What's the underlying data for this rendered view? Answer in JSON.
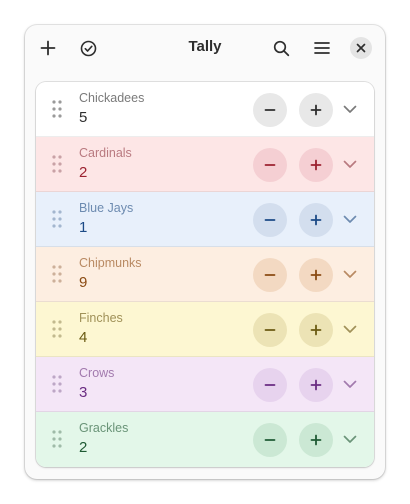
{
  "header": {
    "title": "Tally",
    "icons": [
      "add-icon",
      "check-circle-icon",
      "search-icon",
      "menu-icon",
      "close-icon"
    ]
  },
  "counters": [
    {
      "name": "Chickadees",
      "count": "5",
      "colors": {
        "bg": "#ffffff",
        "name": "#7a7a7a",
        "count": "#2e2e2e",
        "btn": "#e8e8e8",
        "icon": "#2e2e2e",
        "drag": "#9a9a9a",
        "chev": "#7a7a7a"
      }
    },
    {
      "name": "Cardinals",
      "count": "2",
      "colors": {
        "bg": "#fde6e6",
        "name": "#b97a80",
        "count": "#9c2230",
        "btn": "#f5cfd3",
        "icon": "#9c2230",
        "drag": "#c9a2a6",
        "chev": "#b97a80"
      }
    },
    {
      "name": "Blue Jays",
      "count": "1",
      "colors": {
        "bg": "#e8f0fb",
        "name": "#6d8bb0",
        "count": "#1c4a86",
        "btn": "#d3deee",
        "icon": "#1c4a86",
        "drag": "#a3b6cf",
        "chev": "#6d8bb0"
      }
    },
    {
      "name": "Chipmunks",
      "count": "9",
      "colors": {
        "bg": "#fdeee1",
        "name": "#b98a63",
        "count": "#8a4a12",
        "btn": "#f3d9c2",
        "icon": "#8a4a12",
        "drag": "#cdb09a",
        "chev": "#b98a63"
      }
    },
    {
      "name": "Finches",
      "count": "4",
      "colors": {
        "bg": "#fdf7d2",
        "name": "#a09158",
        "count": "#6a5a12",
        "btn": "#ece3b5",
        "icon": "#6a5a12",
        "drag": "#c2b98e",
        "chev": "#a09158"
      }
    },
    {
      "name": "Crows",
      "count": "3",
      "colors": {
        "bg": "#f4e6f7",
        "name": "#a27aae",
        "count": "#6a2c82",
        "btn": "#e7d3ee",
        "icon": "#6a2c82",
        "drag": "#bda7c6",
        "chev": "#a27aae"
      }
    },
    {
      "name": "Grackles",
      "count": "2",
      "colors": {
        "bg": "#e3f7e9",
        "name": "#6a9478",
        "count": "#1f5a34",
        "btn": "#cbe8d4",
        "icon": "#1f5a34",
        "drag": "#9fbba8",
        "chev": "#6a9478"
      }
    }
  ]
}
